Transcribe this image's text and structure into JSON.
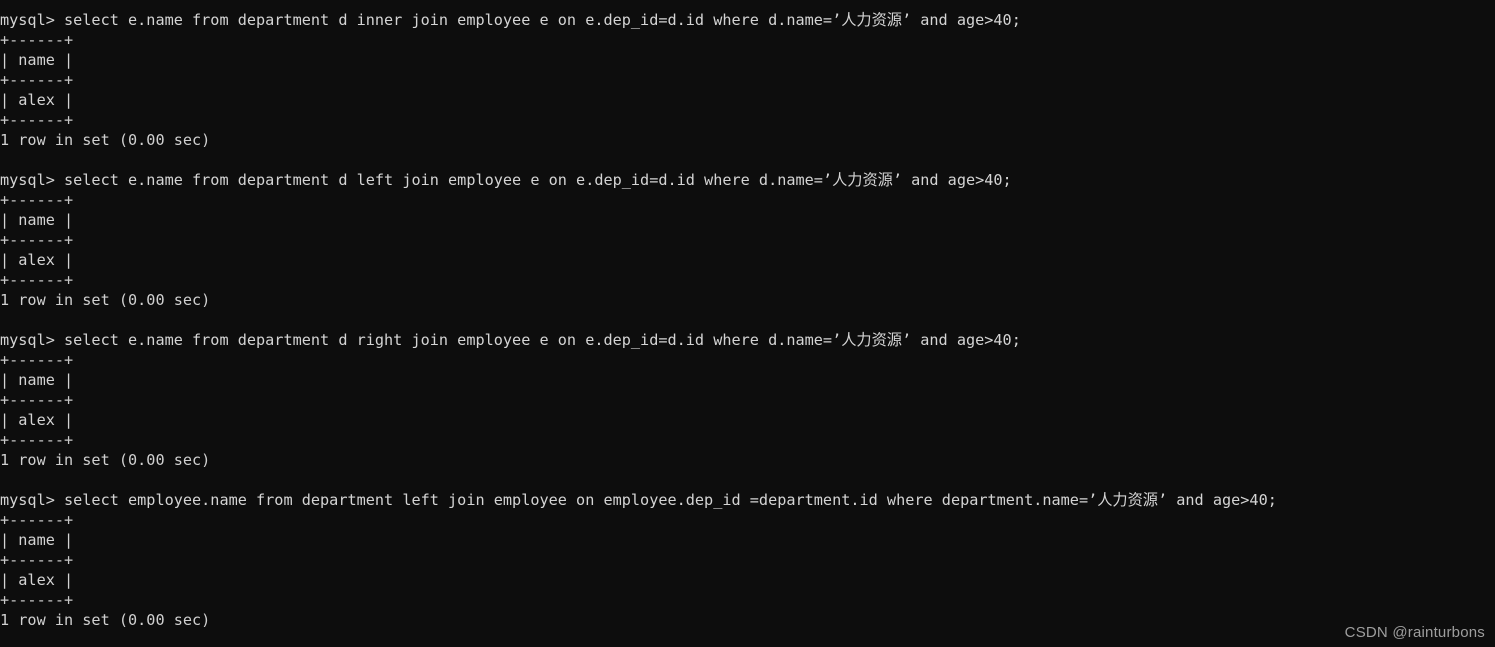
{
  "terminal": {
    "prompt": "mysql> ",
    "background_color": "#0d0d0d",
    "text_color": "#cfcfcf",
    "blocks": [
      {
        "query": "mysql> select e.name from department d inner join employee e on e.dep_id=d.id where d.name=’人力资源’ and age>40;",
        "top_rule": "+------+",
        "header_row": "| name |",
        "mid_rule": "+------+",
        "data_row": "| alex |",
        "bottom_rule": "+------+",
        "status": "1 row in set (0.00 sec)"
      },
      {
        "query": "mysql> select e.name from department d left join employee e on e.dep_id=d.id where d.name=’人力资源’ and age>40;",
        "top_rule": "+------+",
        "header_row": "| name |",
        "mid_rule": "+------+",
        "data_row": "| alex |",
        "bottom_rule": "+------+",
        "status": "1 row in set (0.00 sec)"
      },
      {
        "query": "mysql> select e.name from department d right join employee e on e.dep_id=d.id where d.name=’人力资源’ and age>40;",
        "top_rule": "+------+",
        "header_row": "| name |",
        "mid_rule": "+------+",
        "data_row": "| alex |",
        "bottom_rule": "+------+",
        "status": "1 row in set (0.00 sec)"
      },
      {
        "query": "mysql> select employee.name from department left join employee on employee.dep_id =department.id where department.name=’人力资源’ and age>40;",
        "top_rule": "+------+",
        "header_row": "| name |",
        "mid_rule": "+------+",
        "data_row": "| alex |",
        "bottom_rule": "+------+",
        "status": "1 row in set (0.00 sec)"
      }
    ]
  },
  "watermark": {
    "text": "CSDN @rainturbons",
    "color": "#9e9e9e"
  }
}
